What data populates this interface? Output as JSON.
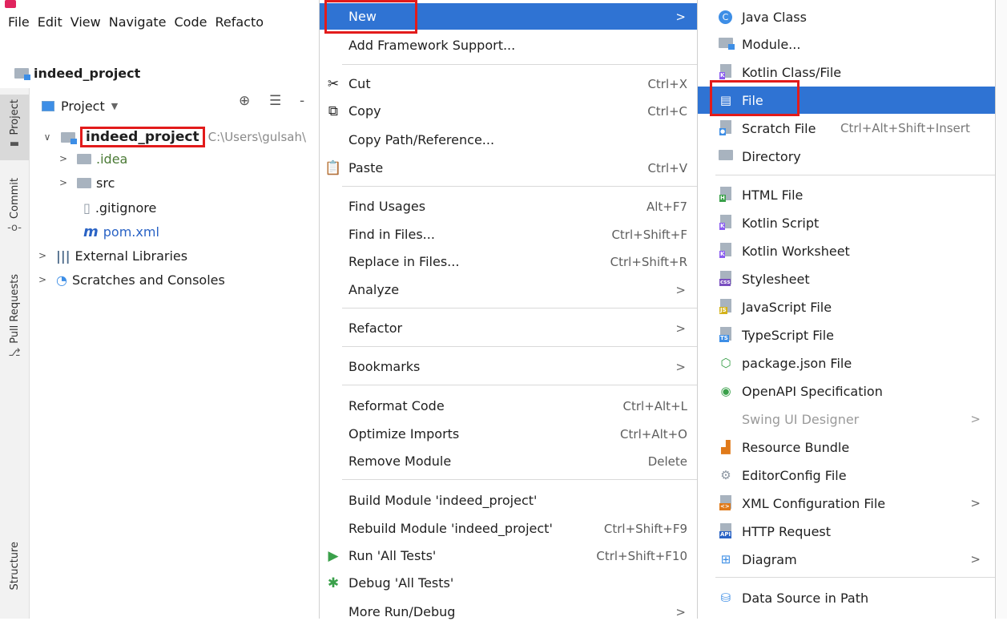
{
  "menubar": {
    "items": [
      "File",
      "Edit",
      "View",
      "Navigate",
      "Code",
      "Refacto"
    ]
  },
  "breadcrumb": {
    "project": "indeed_project"
  },
  "toolwindows": {
    "project": "Project",
    "commit": "Commit",
    "pull_requests": "Pull Requests",
    "structure": "Structure"
  },
  "project_panel": {
    "title": "Project",
    "root": {
      "name": "indeed_project",
      "path": "C:\\Users\\gulsah\\"
    },
    "items": [
      ".idea",
      "src",
      ".gitignore",
      "pom.xml",
      "External Libraries",
      "Scratches and Consoles"
    ]
  },
  "context_menu": {
    "items": [
      {
        "label": "New"
      },
      {
        "label": "Add Framework Support..."
      },
      {
        "label": "Cut",
        "shortcut": "Ctrl+X"
      },
      {
        "label": "Copy",
        "shortcut": "Ctrl+C"
      },
      {
        "label": "Copy Path/Reference..."
      },
      {
        "label": "Paste",
        "shortcut": "Ctrl+V"
      },
      {
        "label": "Find Usages",
        "shortcut": "Alt+F7"
      },
      {
        "label": "Find in Files...",
        "shortcut": "Ctrl+Shift+F"
      },
      {
        "label": "Replace in Files...",
        "shortcut": "Ctrl+Shift+R"
      },
      {
        "label": "Analyze"
      },
      {
        "label": "Refactor"
      },
      {
        "label": "Bookmarks"
      },
      {
        "label": "Reformat Code",
        "shortcut": "Ctrl+Alt+L"
      },
      {
        "label": "Optimize Imports",
        "shortcut": "Ctrl+Alt+O"
      },
      {
        "label": "Remove Module",
        "shortcut": "Delete"
      },
      {
        "label": "Build Module 'indeed_project'"
      },
      {
        "label": "Rebuild Module 'indeed_project'",
        "shortcut": "Ctrl+Shift+F9"
      },
      {
        "label": "Run 'All Tests'",
        "shortcut": "Ctrl+Shift+F10"
      },
      {
        "label": "Debug 'All Tests'"
      },
      {
        "label": "More Run/Debug"
      }
    ]
  },
  "new_submenu": {
    "items": [
      {
        "label": "Java Class"
      },
      {
        "label": "Module..."
      },
      {
        "label": "Kotlin Class/File"
      },
      {
        "label": "File"
      },
      {
        "label": "Scratch File",
        "shortcut": "Ctrl+Alt+Shift+Insert"
      },
      {
        "label": "Directory"
      },
      {
        "label": "HTML File"
      },
      {
        "label": "Kotlin Script"
      },
      {
        "label": "Kotlin Worksheet"
      },
      {
        "label": "Stylesheet"
      },
      {
        "label": "JavaScript File"
      },
      {
        "label": "TypeScript File"
      },
      {
        "label": "package.json File"
      },
      {
        "label": "OpenAPI Specification"
      },
      {
        "label": "Swing UI Designer"
      },
      {
        "label": "Resource Bundle"
      },
      {
        "label": "EditorConfig File"
      },
      {
        "label": "XML Configuration File"
      },
      {
        "label": "HTTP Request"
      },
      {
        "label": "Diagram"
      },
      {
        "label": "Data Source in Path"
      }
    ]
  },
  "colors": {
    "highlight": "#2f73d3",
    "annotation": "#e21b1b"
  }
}
